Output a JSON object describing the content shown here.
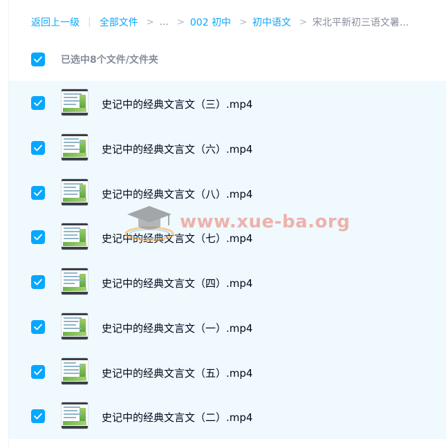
{
  "breadcrumb": {
    "back_label": "返回上一级",
    "separator": "|",
    "items": [
      {
        "label": "全部文件"
      },
      {
        "label": "..."
      },
      {
        "label": "002 初中"
      },
      {
        "label": "初中语文"
      },
      {
        "label": "宋北平新初三语文暑..."
      }
    ],
    "chevron": ">"
  },
  "selection": {
    "summary": "已选中8个文件/文件夹",
    "all_checked": true
  },
  "files": [
    {
      "name": "史记中的经典文言文（三）.mp4",
      "checked": true
    },
    {
      "name": "史记中的经典文言文（六）.mp4",
      "checked": true
    },
    {
      "name": "史记中的经典文言文（八）.mp4",
      "checked": true
    },
    {
      "name": "史记中的经典文言文（七）.mp4",
      "checked": true
    },
    {
      "name": "史记中的经典文言文（四）.mp4",
      "checked": true
    },
    {
      "name": "史记中的经典文言文（一）.mp4",
      "checked": true
    },
    {
      "name": "史记中的经典文言文（五）.mp4",
      "checked": true
    },
    {
      "name": "史记中的经典文言文（二）.mp4",
      "checked": true
    }
  ],
  "watermark": {
    "text": "www.xue-ba.org",
    "icon": "graduation-cap-icon"
  },
  "colors": {
    "accent": "#06a7ff",
    "row_highlight": "#f0f9fe",
    "text_primary": "#03081a",
    "text_secondary": "#878c9c"
  },
  "icons": {
    "checkbox": "checkbox-checked-icon",
    "thumbnail": "video-thumbnail"
  }
}
